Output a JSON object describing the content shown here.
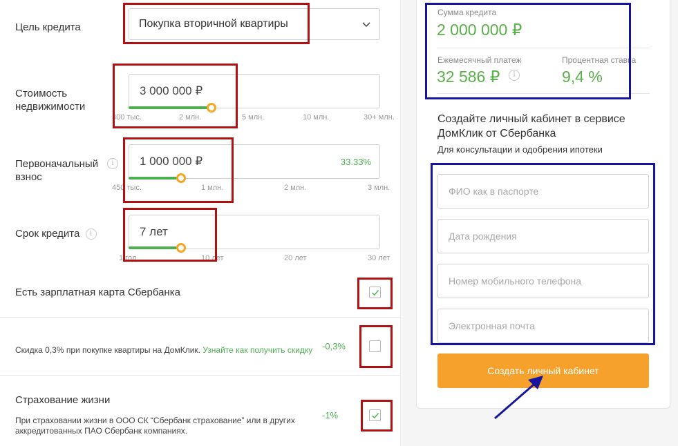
{
  "form": {
    "goal": {
      "label": "Цель кредита",
      "value": "Покупка вторичной квартиры"
    },
    "property": {
      "label_line1": "Стоимость",
      "label_line2": "недвижимости",
      "value": "3 000 000 ₽",
      "ticks": [
        "300 тыс.",
        "2 млн.",
        "5 млн.",
        "10 млн.",
        "30+ млн."
      ],
      "slider_fraction": 0.33
    },
    "downpayment": {
      "label_line1": "Первоначальный",
      "label_line2": "взнос",
      "value": "1 000 000 ₽",
      "percent": "33.33%",
      "ticks": [
        "450 тыс.",
        "1 млн.",
        "2 млн.",
        "3 млн."
      ],
      "slider_fraction": 0.21
    },
    "term": {
      "label": "Срок кредита",
      "value": "7 лет",
      "ticks": [
        "1 год",
        "10 лет",
        "20 лет",
        "30 лет"
      ],
      "slider_fraction": 0.21
    },
    "salary_card": {
      "label": "Есть зарплатная карта Сбербанка",
      "checked": true
    },
    "domclick_discount": {
      "text": "Скидка 0,3% при покупке квартиры на ДомКлик.",
      "link": "Узнайте как получить скидку",
      "discount": "-0,3%",
      "checked": false
    },
    "life_insurance": {
      "label": "Страхование жизни",
      "text_line1": "При страховании жизни в ООО СК “Сбербанк страхование” или в других",
      "text_line2": "аккредитованных ПАО Сбербанк компаниях.",
      "discount": "-1%",
      "checked": true
    }
  },
  "summary": {
    "loan_label": "Сумма кредита",
    "loan_value": "2 000 000 ₽",
    "monthly_label": "Ежемесячный платеж",
    "monthly_value": "32 586 ₽",
    "rate_label": "Процентная ставка",
    "rate_value": "9,4 %"
  },
  "signup": {
    "heading": "Создайте личный кабинет в сервисе ДомКлик от Сбербанка",
    "subheading": "Для консультации и одобрения ипотеки",
    "name_placeholder": "ФИО как в паспорте",
    "birth_placeholder": "Дата рождения",
    "phone_placeholder": "Номер мобильного телефона",
    "email_placeholder": "Электронная почта",
    "button": "Создать личный кабинет"
  },
  "colors": {
    "accent_green": "#4caf50",
    "thumb_orange": "#f5a623",
    "button_orange": "#f5a12b",
    "annotation_red": "#b01010",
    "annotation_blue": "#1515a0"
  },
  "icons": [
    "chevron-down-icon",
    "info-icon",
    "check-icon",
    "ruble-icon",
    "arrow-annotation"
  ]
}
